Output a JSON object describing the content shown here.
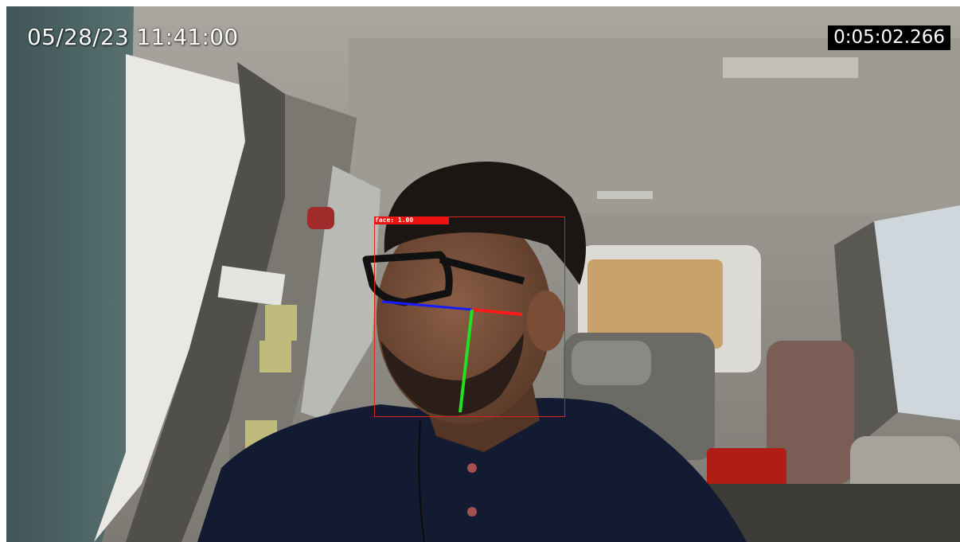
{
  "overlay": {
    "datetime": "05/28/23 11:41:00",
    "elapsed": "0:05:02.266",
    "face_label": "face: 1.00"
  },
  "colors": {
    "box": "#e0201c",
    "label_bg": "#ee1111",
    "axis_x": "#ff1a1a",
    "axis_y": "#22e022",
    "axis_z": "#1a1aff"
  },
  "scene": "car-interior-driver-monitoring"
}
